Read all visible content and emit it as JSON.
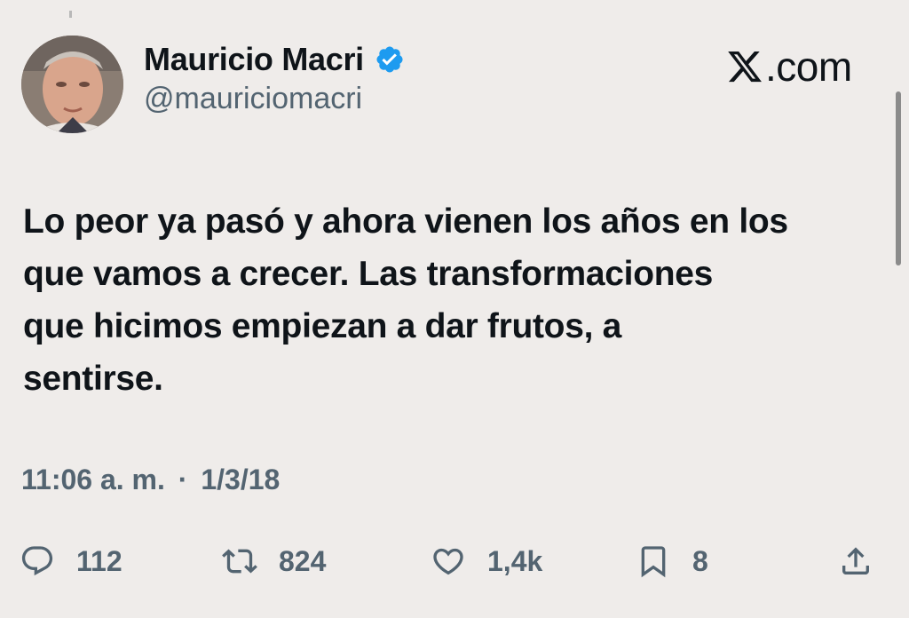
{
  "author": {
    "name": "Mauricio Macri",
    "handle": "@mauriciomacri",
    "verified": true
  },
  "brand": {
    "text": ".com",
    "icon": "x-logo-icon"
  },
  "tweet": {
    "lines": [
      "Lo peor ya pasó y ahora vienen los años en los",
      "que vamos a crecer. Las transformaciones",
      "que hicimos empiezan a dar frutos, a",
      "sentirse."
    ]
  },
  "meta": {
    "time": "11:06 a. m.",
    "separator": "·",
    "date": "1/3/18"
  },
  "actions": {
    "replies": {
      "icon": "reply-icon",
      "count": "112"
    },
    "reposts": {
      "icon": "repost-icon",
      "count": "824"
    },
    "likes": {
      "icon": "heart-icon",
      "count": "1,4k"
    },
    "bookmarks": {
      "icon": "bookmark-icon",
      "count": "8"
    },
    "share": {
      "icon": "share-icon"
    }
  },
  "colors": {
    "background": "#efecea",
    "text": "#0f1419",
    "secondary": "#536471",
    "verified": "#1d9bf0"
  }
}
